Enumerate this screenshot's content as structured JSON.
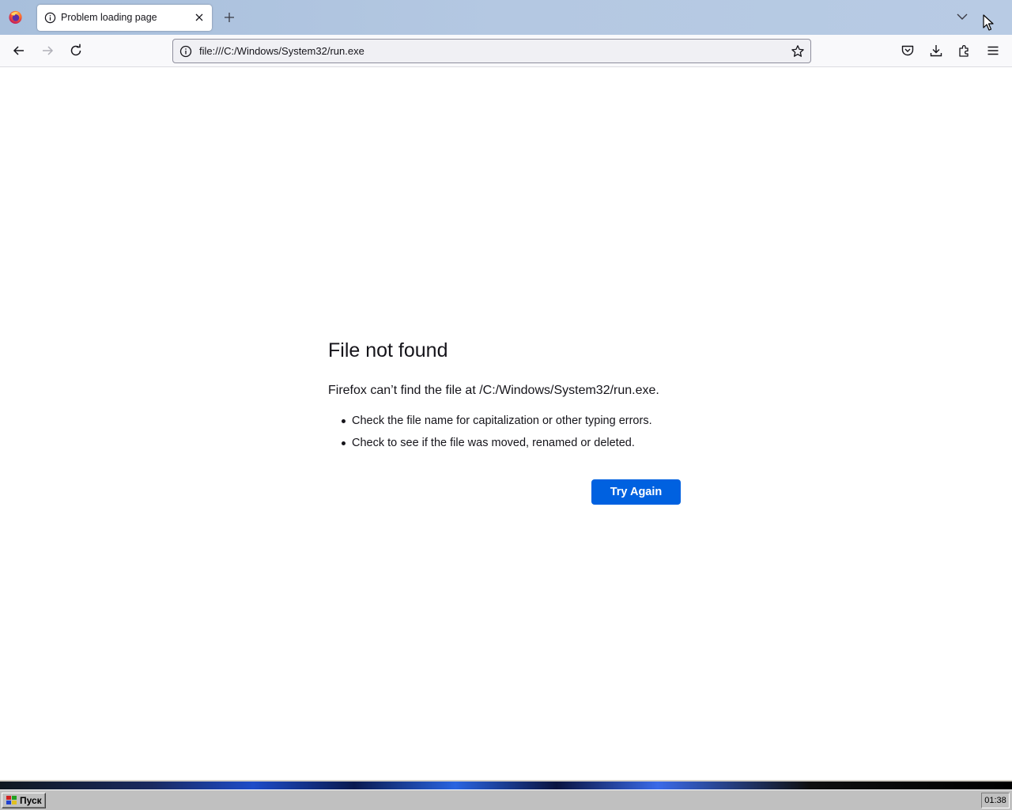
{
  "browser": {
    "tab": {
      "title": "Problem loading page"
    },
    "url": "file:///C:/Windows/System32/run.exe"
  },
  "error_page": {
    "title": "File not found",
    "description": "Firefox can’t find the file at /C:/Windows/System32/run.exe.",
    "suggestions": [
      "Check the file name for capitalization or other typing errors.",
      "Check to see if the file was moved, renamed or deleted."
    ],
    "try_again_label": "Try Again"
  },
  "taskbar": {
    "start_label": "Пуск",
    "clock": "01:38"
  },
  "colors": {
    "accent": "#0061e0",
    "tabstrip": "#b4c8e2"
  }
}
